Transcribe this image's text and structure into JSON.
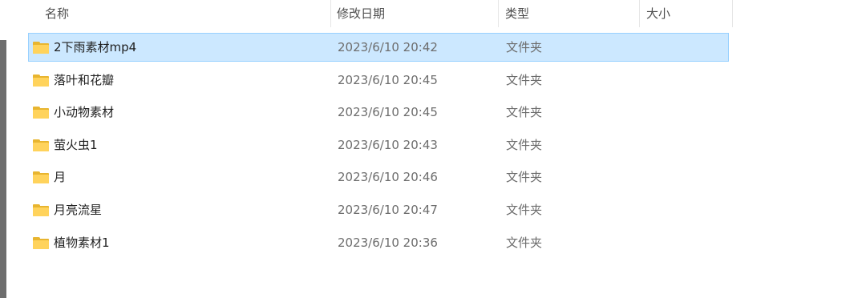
{
  "colors": {
    "selected_row_bg": "#cce8ff",
    "selected_row_border": "#99d1ff",
    "folder_body": "#ffd35c",
    "folder_tab": "#e8b530"
  },
  "header": {
    "sort_indicator": "^",
    "name": "名称",
    "modified": "修改日期",
    "type": "类型",
    "size": "大小"
  },
  "files": [
    {
      "icon": "folder-icon",
      "name": "2下雨素材mp4",
      "modified": "2023/6/10 20:42",
      "type": "文件夹",
      "selected": true
    },
    {
      "icon": "folder-icon",
      "name": "落叶和花瓣",
      "modified": "2023/6/10 20:45",
      "type": "文件夹",
      "selected": false
    },
    {
      "icon": "folder-icon",
      "name": "小动物素材",
      "modified": "2023/6/10 20:45",
      "type": "文件夹",
      "selected": false
    },
    {
      "icon": "folder-icon",
      "name": "萤火虫1",
      "modified": "2023/6/10 20:43",
      "type": "文件夹",
      "selected": false
    },
    {
      "icon": "folder-icon",
      "name": "月",
      "modified": "2023/6/10 20:46",
      "type": "文件夹",
      "selected": false
    },
    {
      "icon": "folder-icon",
      "name": "月亮流星",
      "modified": "2023/6/10 20:47",
      "type": "文件夹",
      "selected": false
    },
    {
      "icon": "folder-icon",
      "name": "植物素材1",
      "modified": "2023/6/10 20:36",
      "type": "文件夹",
      "selected": false
    }
  ]
}
